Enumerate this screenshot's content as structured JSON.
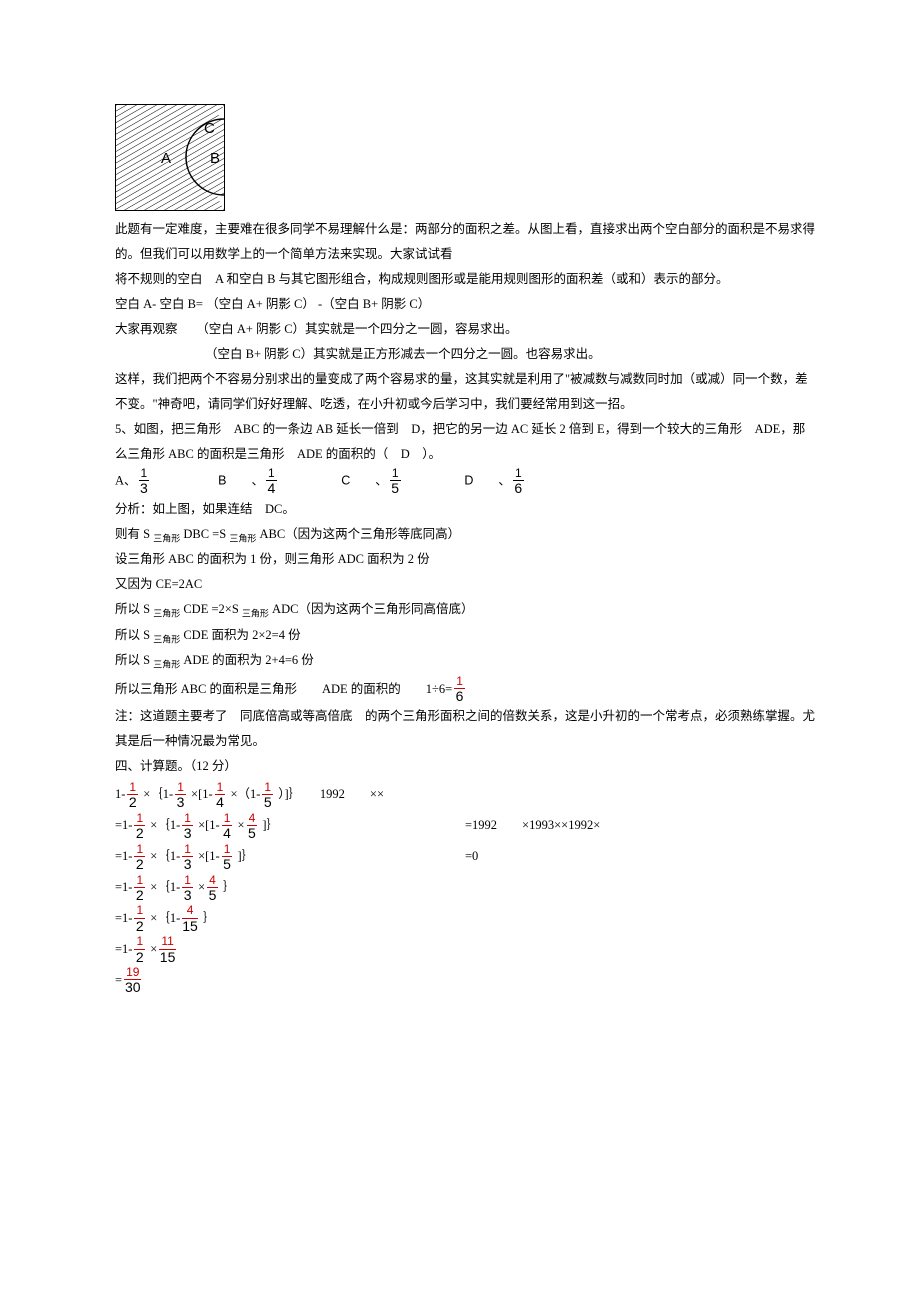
{
  "diagram": {
    "A": "A",
    "B": "B",
    "C": "C"
  },
  "p1": "此题有一定难度，主要难在很多同学不易理解什么是：两部分的面积之差。从图上看，直接求出两个空白部分的面积是不易求得的。但我们可以用数学上的一个简单方法来实现。大家试试看",
  "p2": "将不规则的空白　A 和空白 B 与其它图形组合，构成规则图形或是能用规则图形的面积差（或和）表示的部分。",
  "p3": "空白 A- 空白 B= （空白 A+ 阴影 C） -（空白 B+ 阴影 C）",
  "p4": "大家再观察　　（空白 A+ 阴影 C）其实就是一个四分之一圆，容易求出。",
  "p5": "（空白 B+ 阴影 C）其实就是正方形减去一个四分之一圆。也容易求出。",
  "p6": "这样，我们把两个不容易分别求出的量变成了两个容易求的量，这其实就是利用了\"被减数与减数同时加（或减）同一个数，差不变。\"神奇吧，请同学们好好理解、吃透，在小升初或今后学习中，我们要经常用到这一招。",
  "q5": "5、如图，把三角形　ABC 的一条边 AB 延长一倍到　D，把它的另一边 AC 延长 2 倍到 E，得到一个较大的三角形　ADE，那么三角形 ABC 的面积是三角形　ADE 的面积的（　D　）。",
  "opts": {
    "A": "A、",
    "B": "B",
    "C": "C",
    "D": "D",
    "sep": "、"
  },
  "a1": "分析：如上图，如果连结　DC。",
  "a2_1": "则有 S ",
  "a2_s1": "三角形",
  "a2_2": " DBC =S ",
  "a2_s2": "三角形",
  "a2_3": " ABC（因为这两个三角形等底同高）",
  "a3": "设三角形 ABC 的面积为 1 份，则三角形 ADC 面积为 2 份",
  "a4": "又因为 CE=2AC",
  "a5_1": "所以 S ",
  "a5_s1": "三角形",
  "a5_2": " CDE =2×S ",
  "a5_s2": "三角形",
  "a5_3": " ADC（因为这两个三角形同高倍底）",
  "a6_1": "所以 S ",
  "a6_s1": "三角形",
  "a6_2": " CDE 面积为 2×2=4 份",
  "a7_1": "所以 S ",
  "a7_s1": "三角形",
  "a7_2": " ADE 的面积为 2+4=6 份",
  "a8_1": "所以三角形 ABC 的面积是三角形　　ADE 的面积的　　1÷6=",
  "note": "注：这道题主要考了　同底倍高或等高倍底　的两个三角形面积之间的倍数关系，这是小升初的一个常考点，必须熟练掌握。尤其是后一种情况最为常见。",
  "sec4": "四、计算题。（12 分）",
  "c1_a": "1-",
  "c1_b": "×｛1-",
  "c1_c": "×[1-",
  "c1_d": "×（1-",
  "c1_e": "）]｝　　1992　　××",
  "c2_a": "=1-",
  "c2_b": "×｛1-",
  "c2_c": "×[1-",
  "c2_d": "×",
  "c2_e": "]｝",
  "c2_f": "=1992　　×1993××1992×",
  "c3_a": "=1-",
  "c3_b": "×｛1-",
  "c3_c": "×[1-",
  "c3_d": "]｝",
  "c3_e": "=0",
  "c4_a": "=1-",
  "c4_b": "×｛1-",
  "c4_c": "×",
  "c4_d": "｝",
  "c5_a": "=1-",
  "c5_b": "×｛1-",
  "c5_c": "｝",
  "c6_a": "=1-",
  "c6_b": "×",
  "c7_a": "=",
  "f": {
    "n1": "1",
    "d2": "2",
    "d3": "3",
    "d4": "4",
    "d5": "5",
    "d6": "6",
    "n4": "4",
    "n11": "11",
    "d15": "15",
    "n19": "19",
    "d30": "30"
  }
}
